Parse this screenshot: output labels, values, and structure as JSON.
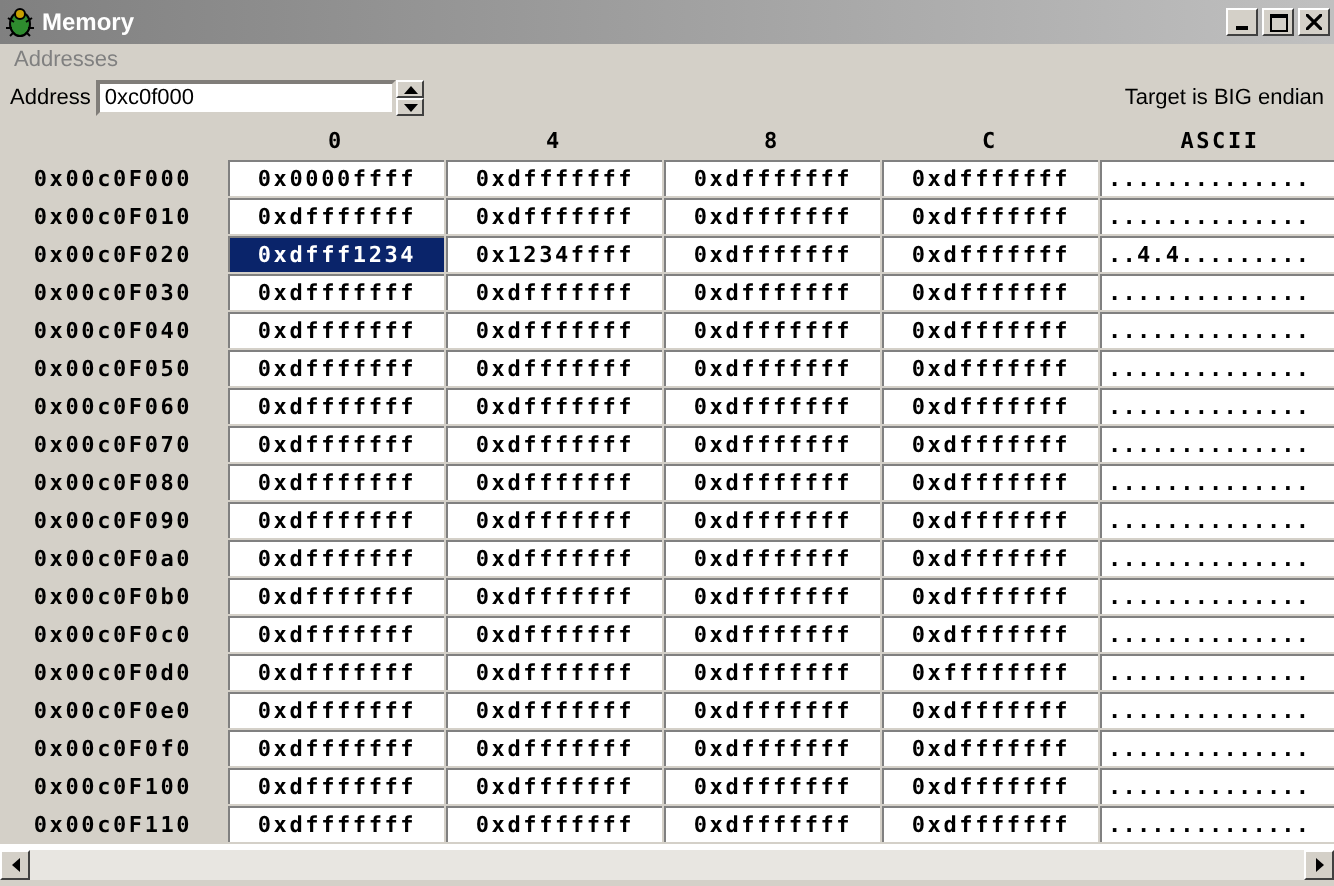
{
  "window": {
    "title": "Memory"
  },
  "menu": [
    "Addresses"
  ],
  "address": {
    "label": "Address",
    "value": "0xc0f000"
  },
  "endian_note": "Target is BIG endian",
  "columns": [
    "0",
    "4",
    "8",
    "C",
    "ASCII"
  ],
  "rows": [
    {
      "address": "0x00c0F000",
      "cells": [
        {
          "value": "0x0000ffff",
          "selected": false
        },
        {
          "value": "0xdfffffff",
          "selected": false
        },
        {
          "value": "0xdfffffff",
          "selected": false
        },
        {
          "value": "0xdfffffff",
          "selected": false
        }
      ],
      "ascii": ".............."
    },
    {
      "address": "0x00c0F010",
      "cells": [
        {
          "value": "0xdfffffff",
          "selected": false
        },
        {
          "value": "0xdfffffff",
          "selected": false
        },
        {
          "value": "0xdfffffff",
          "selected": false
        },
        {
          "value": "0xdfffffff",
          "selected": false
        }
      ],
      "ascii": ".............."
    },
    {
      "address": "0x00c0F020",
      "cells": [
        {
          "value": "0xdfff1234",
          "selected": true
        },
        {
          "value": "0x1234ffff",
          "selected": false
        },
        {
          "value": "0xdfffffff",
          "selected": false
        },
        {
          "value": "0xdfffffff",
          "selected": false
        }
      ],
      "ascii": "..4.4........."
    },
    {
      "address": "0x00c0F030",
      "cells": [
        {
          "value": "0xdfffffff",
          "selected": false
        },
        {
          "value": "0xdfffffff",
          "selected": false
        },
        {
          "value": "0xdfffffff",
          "selected": false
        },
        {
          "value": "0xdfffffff",
          "selected": false
        }
      ],
      "ascii": ".............."
    },
    {
      "address": "0x00c0F040",
      "cells": [
        {
          "value": "0xdfffffff",
          "selected": false
        },
        {
          "value": "0xdfffffff",
          "selected": false
        },
        {
          "value": "0xdfffffff",
          "selected": false
        },
        {
          "value": "0xdfffffff",
          "selected": false
        }
      ],
      "ascii": ".............."
    },
    {
      "address": "0x00c0F050",
      "cells": [
        {
          "value": "0xdfffffff",
          "selected": false
        },
        {
          "value": "0xdfffffff",
          "selected": false
        },
        {
          "value": "0xdfffffff",
          "selected": false
        },
        {
          "value": "0xdfffffff",
          "selected": false
        }
      ],
      "ascii": ".............."
    },
    {
      "address": "0x00c0F060",
      "cells": [
        {
          "value": "0xdfffffff",
          "selected": false
        },
        {
          "value": "0xdfffffff",
          "selected": false
        },
        {
          "value": "0xdfffffff",
          "selected": false
        },
        {
          "value": "0xdfffffff",
          "selected": false
        }
      ],
      "ascii": ".............."
    },
    {
      "address": "0x00c0F070",
      "cells": [
        {
          "value": "0xdfffffff",
          "selected": false
        },
        {
          "value": "0xdfffffff",
          "selected": false
        },
        {
          "value": "0xdfffffff",
          "selected": false
        },
        {
          "value": "0xdfffffff",
          "selected": false
        }
      ],
      "ascii": ".............."
    },
    {
      "address": "0x00c0F080",
      "cells": [
        {
          "value": "0xdfffffff",
          "selected": false
        },
        {
          "value": "0xdfffffff",
          "selected": false
        },
        {
          "value": "0xdfffffff",
          "selected": false
        },
        {
          "value": "0xdfffffff",
          "selected": false
        }
      ],
      "ascii": ".............."
    },
    {
      "address": "0x00c0F090",
      "cells": [
        {
          "value": "0xdfffffff",
          "selected": false
        },
        {
          "value": "0xdfffffff",
          "selected": false
        },
        {
          "value": "0xdfffffff",
          "selected": false
        },
        {
          "value": "0xdfffffff",
          "selected": false
        }
      ],
      "ascii": ".............."
    },
    {
      "address": "0x00c0F0a0",
      "cells": [
        {
          "value": "0xdfffffff",
          "selected": false
        },
        {
          "value": "0xdfffffff",
          "selected": false
        },
        {
          "value": "0xdfffffff",
          "selected": false
        },
        {
          "value": "0xdfffffff",
          "selected": false
        }
      ],
      "ascii": ".............."
    },
    {
      "address": "0x00c0F0b0",
      "cells": [
        {
          "value": "0xdfffffff",
          "selected": false
        },
        {
          "value": "0xdfffffff",
          "selected": false
        },
        {
          "value": "0xdfffffff",
          "selected": false
        },
        {
          "value": "0xdfffffff",
          "selected": false
        }
      ],
      "ascii": ".............."
    },
    {
      "address": "0x00c0F0c0",
      "cells": [
        {
          "value": "0xdfffffff",
          "selected": false
        },
        {
          "value": "0xdfffffff",
          "selected": false
        },
        {
          "value": "0xdfffffff",
          "selected": false
        },
        {
          "value": "0xdfffffff",
          "selected": false
        }
      ],
      "ascii": ".............."
    },
    {
      "address": "0x00c0F0d0",
      "cells": [
        {
          "value": "0xdfffffff",
          "selected": false
        },
        {
          "value": "0xdfffffff",
          "selected": false
        },
        {
          "value": "0xdfffffff",
          "selected": false
        },
        {
          "value": "0xffffffff",
          "selected": false
        }
      ],
      "ascii": ".............."
    },
    {
      "address": "0x00c0F0e0",
      "cells": [
        {
          "value": "0xdfffffff",
          "selected": false
        },
        {
          "value": "0xdfffffff",
          "selected": false
        },
        {
          "value": "0xdfffffff",
          "selected": false
        },
        {
          "value": "0xdfffffff",
          "selected": false
        }
      ],
      "ascii": ".............."
    },
    {
      "address": "0x00c0F0f0",
      "cells": [
        {
          "value": "0xdfffffff",
          "selected": false
        },
        {
          "value": "0xdfffffff",
          "selected": false
        },
        {
          "value": "0xdfffffff",
          "selected": false
        },
        {
          "value": "0xdfffffff",
          "selected": false
        }
      ],
      "ascii": ".............."
    },
    {
      "address": "0x00c0F100",
      "cells": [
        {
          "value": "0xdfffffff",
          "selected": false
        },
        {
          "value": "0xdfffffff",
          "selected": false
        },
        {
          "value": "0xdfffffff",
          "selected": false
        },
        {
          "value": "0xdfffffff",
          "selected": false
        }
      ],
      "ascii": ".............."
    },
    {
      "address": "0x00c0F110",
      "cells": [
        {
          "value": "0xdfffffff",
          "selected": false
        },
        {
          "value": "0xdfffffff",
          "selected": false
        },
        {
          "value": "0xdfffffff",
          "selected": false
        },
        {
          "value": "0xdfffffff",
          "selected": false
        }
      ],
      "ascii": ".............."
    }
  ]
}
